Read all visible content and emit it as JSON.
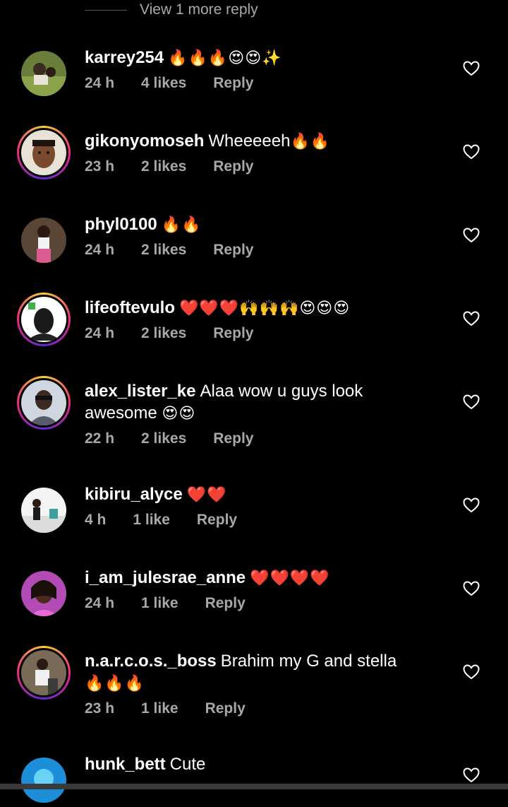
{
  "view_more": "View 1 more reply",
  "comments": [
    {
      "username": "karrey254",
      "text": "",
      "emoji": "🔥🔥🔥😍😍✨",
      "time": "24 h",
      "likes": "4 likes",
      "reply": "Reply"
    },
    {
      "username": "gikonyomoseh",
      "text": "Wheeeeeh",
      "emoji": "🔥🔥",
      "time": "23 h",
      "likes": "2 likes",
      "reply": "Reply"
    },
    {
      "username": "phyl0100",
      "text": "",
      "emoji": "🔥🔥",
      "time": "24 h",
      "likes": "2 likes",
      "reply": "Reply"
    },
    {
      "username": "lifeoftevulo",
      "text": "",
      "emoji": "❤️❤️❤️🙌🙌🙌😍😍😍",
      "time": "24 h",
      "likes": "2 likes",
      "reply": "Reply"
    },
    {
      "username": "alex_lister_ke",
      "text": "Alaa wow u guys look awesome",
      "emoji": "😍😍",
      "time": "22 h",
      "likes": "2 likes",
      "reply": "Reply"
    },
    {
      "username": "kibiru_alyce",
      "text": "",
      "emoji": "❤️❤️",
      "time": "4 h",
      "likes": "1 like",
      "reply": "Reply"
    },
    {
      "username": "i_am_julesrae_anne",
      "text": "",
      "emoji": "❤️❤️❤️❤️",
      "time": "24 h",
      "likes": "1 like",
      "reply": "Reply"
    },
    {
      "username": "n.a.r.c.o.s._boss",
      "text": "Brahim my G and stella",
      "emoji": "🔥🔥🔥",
      "time": "23 h",
      "likes": "1 like",
      "reply": "Reply"
    },
    {
      "username": "hunk_bett",
      "text": "Cute",
      "emoji": "",
      "time": "",
      "likes": "",
      "reply": ""
    }
  ],
  "icons": {
    "like": "heart-outline-icon"
  },
  "colors": {
    "background": "#000000",
    "text": "#ffffff",
    "secondary": "#a8a8a8"
  }
}
